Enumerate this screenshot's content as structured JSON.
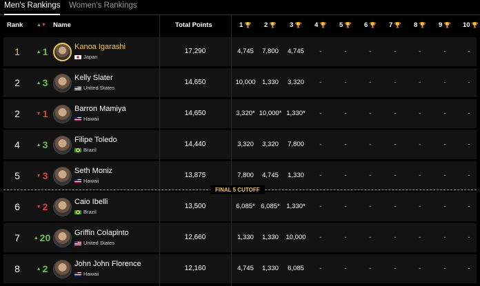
{
  "tabs": [
    {
      "label": "Men's Rankings",
      "active": true
    },
    {
      "label": "Women's Rankings",
      "active": false
    }
  ],
  "header": {
    "rank": "Rank",
    "name": "Name",
    "total_points": "Total Points",
    "events": [
      "1",
      "2",
      "3",
      "4",
      "5",
      "6",
      "7",
      "8",
      "9",
      "10"
    ]
  },
  "cutoff_label": "FINAL 5 CUTOFF",
  "colors": {
    "gold": "#f2c84b",
    "up": "#6dbf4b",
    "down": "#e0413a"
  },
  "rows": [
    {
      "rank": "1",
      "move": "1",
      "dir": "up",
      "name": "Kanoa Igarashi",
      "country": "Japan",
      "flag": "japan-flag-icon",
      "points": "17,290",
      "events": [
        "4,745",
        "7,800",
        "4,745",
        "-",
        "-",
        "-",
        "-",
        "-",
        "-",
        "-"
      ],
      "highlight": true
    },
    {
      "rank": "2",
      "move": "3",
      "dir": "up",
      "name": "Kelly Slater",
      "country": "United States",
      "flag": "usa-flag-icon",
      "points": "14,650",
      "events": [
        "10,000",
        "1,330",
        "3,320",
        "-",
        "-",
        "-",
        "-",
        "-",
        "-",
        "-"
      ],
      "highlight": false
    },
    {
      "rank": "2",
      "move": "1",
      "dir": "down",
      "name": "Barron Mamiya",
      "country": "Hawaii",
      "flag": "hawaii-flag-icon",
      "points": "14,650",
      "events": [
        "3,320*",
        "10,000*",
        "1,330*",
        "-",
        "-",
        "-",
        "-",
        "-",
        "-",
        "-"
      ],
      "highlight": false
    },
    {
      "rank": "4",
      "move": "3",
      "dir": "up",
      "name": "Filipe Toledo",
      "country": "Brazil",
      "flag": "brazil-flag-icon",
      "points": "14,440",
      "events": [
        "3,320",
        "3,320",
        "7,800",
        "-",
        "-",
        "-",
        "-",
        "-",
        "-",
        "-"
      ],
      "highlight": false
    },
    {
      "rank": "5",
      "move": "3",
      "dir": "down",
      "name": "Seth Moniz",
      "country": "Hawaii",
      "flag": "hawaii-flag-icon",
      "points": "13,875",
      "events": [
        "7,800",
        "4,745",
        "1,330",
        "-",
        "-",
        "-",
        "-",
        "-",
        "-",
        "-"
      ],
      "highlight": false
    },
    {
      "rank": "6",
      "move": "2",
      "dir": "down",
      "name": "Caio Ibelli",
      "country": "Brazil",
      "flag": "brazil-flag-icon",
      "points": "13,500",
      "events": [
        "6,085*",
        "6,085*",
        "1,330*",
        "-",
        "-",
        "-",
        "-",
        "-",
        "-",
        "-"
      ],
      "highlight": false
    },
    {
      "rank": "7",
      "move": "20",
      "dir": "up",
      "name": "Griffin Colapinto",
      "country": "United States",
      "flag": "usa-flag-icon",
      "points": "12,660",
      "events": [
        "1,330",
        "1,330",
        "10,000",
        "-",
        "-",
        "-",
        "-",
        "-",
        "-",
        "-"
      ],
      "highlight": false
    },
    {
      "rank": "8",
      "move": "2",
      "dir": "up",
      "name": "John John Florence",
      "country": "Hawaii",
      "flag": "hawaii-flag-icon",
      "points": "12,160",
      "events": [
        "4,745",
        "1,330",
        "6,085",
        "-",
        "-",
        "-",
        "-",
        "-",
        "-",
        "-"
      ],
      "highlight": false
    }
  ]
}
